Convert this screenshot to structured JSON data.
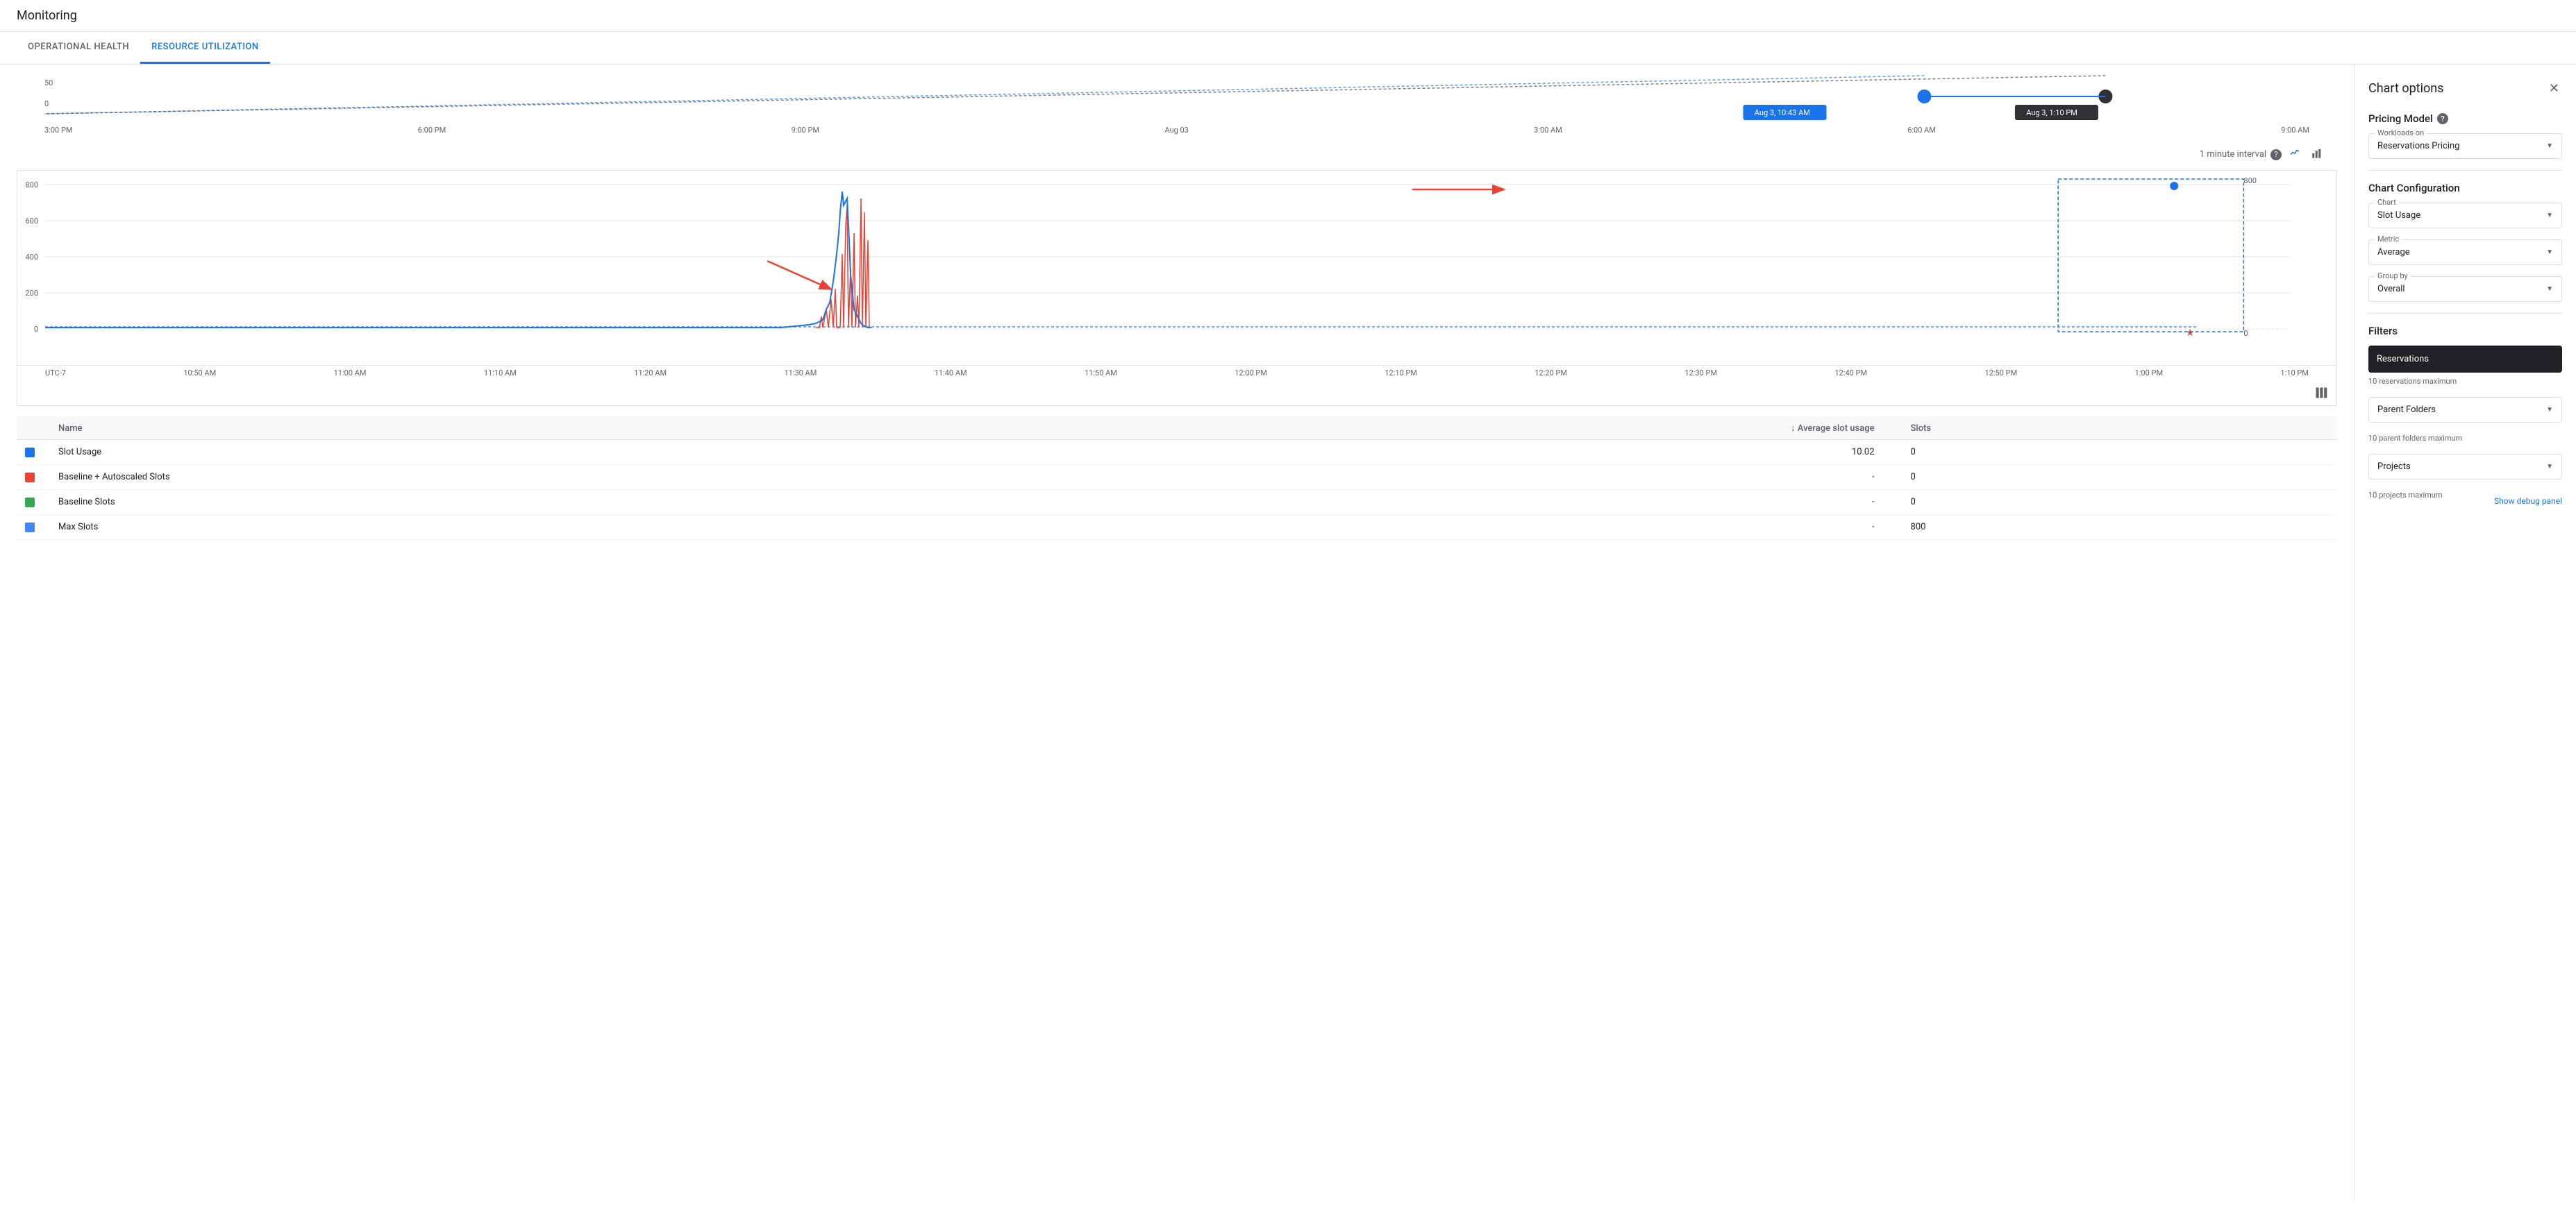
{
  "header": {
    "title": "Monitoring"
  },
  "tabs": [
    {
      "id": "operational-health",
      "label": "OPERATIONAL HEALTH",
      "active": false
    },
    {
      "id": "resource-utilization",
      "label": "RESOURCE UTILIZATION",
      "active": true
    }
  ],
  "timeline": {
    "labels": [
      "3:00 PM",
      "6:00 PM",
      "9:00 PM",
      "Aug 03",
      "3:00 AM",
      "6:00 AM",
      "9:00 AM"
    ],
    "range_start_label": "Aug 3, 10:43 AM",
    "range_end_label": "Aug 3, 1:10 PM",
    "y_labels": [
      "50",
      "0"
    ]
  },
  "chart": {
    "interval_label": "1 minute interval",
    "x_labels": [
      "UTC-7",
      "10:50 AM",
      "11:00 AM",
      "11:10 AM",
      "11:20 AM",
      "11:30 AM",
      "11:40 AM",
      "11:50 AM",
      "12:00 PM",
      "12:10 PM",
      "12:20 PM",
      "12:30 PM",
      "12:40 PM",
      "12:50 PM",
      "1:00 PM",
      "1:10 PM"
    ],
    "y_labels": [
      "800",
      "600",
      "400",
      "200",
      "0"
    ],
    "dot_label": "800",
    "star_label": "0"
  },
  "legend": {
    "headers": [
      "Name",
      "Average slot usage",
      "Slots"
    ],
    "rows": [
      {
        "color": "#1a73e8",
        "shape": "square",
        "name": "Slot Usage",
        "avg": "10.02",
        "slots": "0"
      },
      {
        "color": "#ea4335",
        "shape": "square",
        "name": "Baseline + Autoscaled Slots",
        "avg": "-",
        "slots": "0"
      },
      {
        "color": "#34a853",
        "shape": "square",
        "name": "Baseline Slots",
        "avg": "-",
        "slots": "0"
      },
      {
        "color": "#4285f4",
        "shape": "square",
        "name": "Max Slots",
        "avg": "-",
        "slots": "800"
      }
    ]
  },
  "right_panel": {
    "title": "Chart options",
    "close_label": "✕",
    "pricing_model": {
      "title": "Pricing Model",
      "workloads_label": "Workloads on",
      "workloads_value": "Reservations Pricing"
    },
    "chart_config": {
      "title": "Chart Configuration",
      "chart_label": "Chart",
      "chart_value": "Slot Usage",
      "metric_label": "Metric",
      "metric_value": "Average",
      "group_by_label": "Group by",
      "group_by_value": "Overall"
    },
    "filters": {
      "title": "Filters",
      "reservations_label": "Reservations",
      "reservations_hint": "10 reservations maximum",
      "parent_folders_label": "Parent Folders",
      "parent_folders_hint": "10 parent folders maximum",
      "projects_label": "Projects",
      "projects_hint": "10 projects maximum",
      "debug_label": "Show debug panel"
    }
  }
}
